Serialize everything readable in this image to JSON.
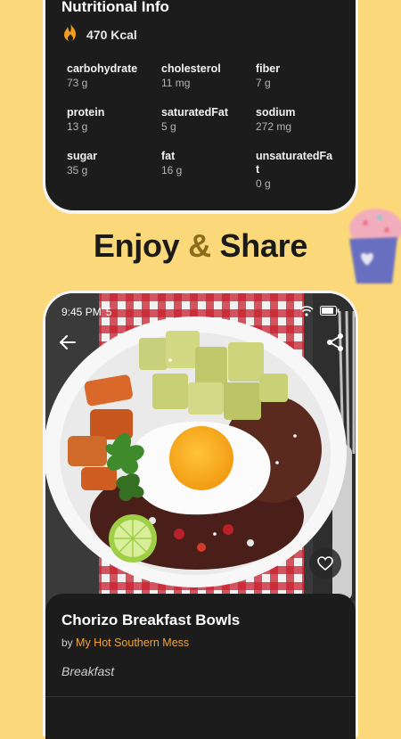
{
  "nutrition": {
    "title": "Nutritional Info",
    "kcal": "470 Kcal",
    "items": [
      {
        "name": "carbohydrate",
        "value": "73 g"
      },
      {
        "name": "cholesterol",
        "value": "11 mg"
      },
      {
        "name": "fiber",
        "value": "7 g"
      },
      {
        "name": "protein",
        "value": "13 g"
      },
      {
        "name": "saturatedFat",
        "value": "5 g"
      },
      {
        "name": "sodium",
        "value": "272 mg"
      },
      {
        "name": "sugar",
        "value": "35 g"
      },
      {
        "name": "fat",
        "value": "16 g"
      },
      {
        "name": "unsaturatedFat",
        "value": "0 g"
      }
    ]
  },
  "headline": {
    "part1": "Enjoy",
    "amp": "&",
    "part2": "Share"
  },
  "status_bar": {
    "time": "9:45 PM",
    "extra": "5"
  },
  "recipe": {
    "title": "Chorizo Breakfast Bowls",
    "by_label": "by",
    "author": "My Hot Southern Mess",
    "category": "Breakfast"
  },
  "icons": {
    "calories": "flame-icon",
    "back": "arrow-left-icon",
    "share": "share-icon",
    "favorite": "heart-icon"
  },
  "colors": {
    "background": "#fbd97a",
    "card": "#1c1c1c",
    "accent": "#f0a43a",
    "amp": "#8a6d1c"
  }
}
